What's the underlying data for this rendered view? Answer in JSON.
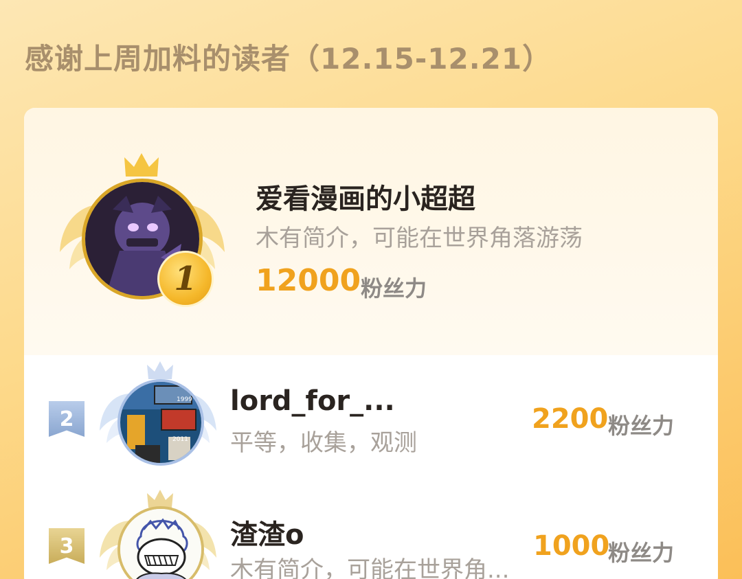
{
  "header": {
    "title": "感谢上周加料的读者（12.15-12.21）"
  },
  "rank1": {
    "rank": "1",
    "name": "爱看漫画的小超超",
    "bio": "木有简介，可能在世界角落游荡",
    "score": "12000",
    "unit": "粉丝力"
  },
  "others": [
    {
      "rank": "2",
      "name": "lord_for_...",
      "bio": "平等，收集，观测",
      "score": "2200",
      "unit": "粉丝力",
      "avatar_labels": [
        "1999",
        "2011"
      ]
    },
    {
      "rank": "3",
      "name": "渣渣o",
      "bio": "木有简介，可能在世界角...",
      "score": "1000",
      "unit": "粉丝力"
    }
  ],
  "colors": {
    "accent": "#f0a21e",
    "gold": "#d9a627",
    "silver": "#8aa6d0",
    "bronze": "#c9ad5a"
  }
}
